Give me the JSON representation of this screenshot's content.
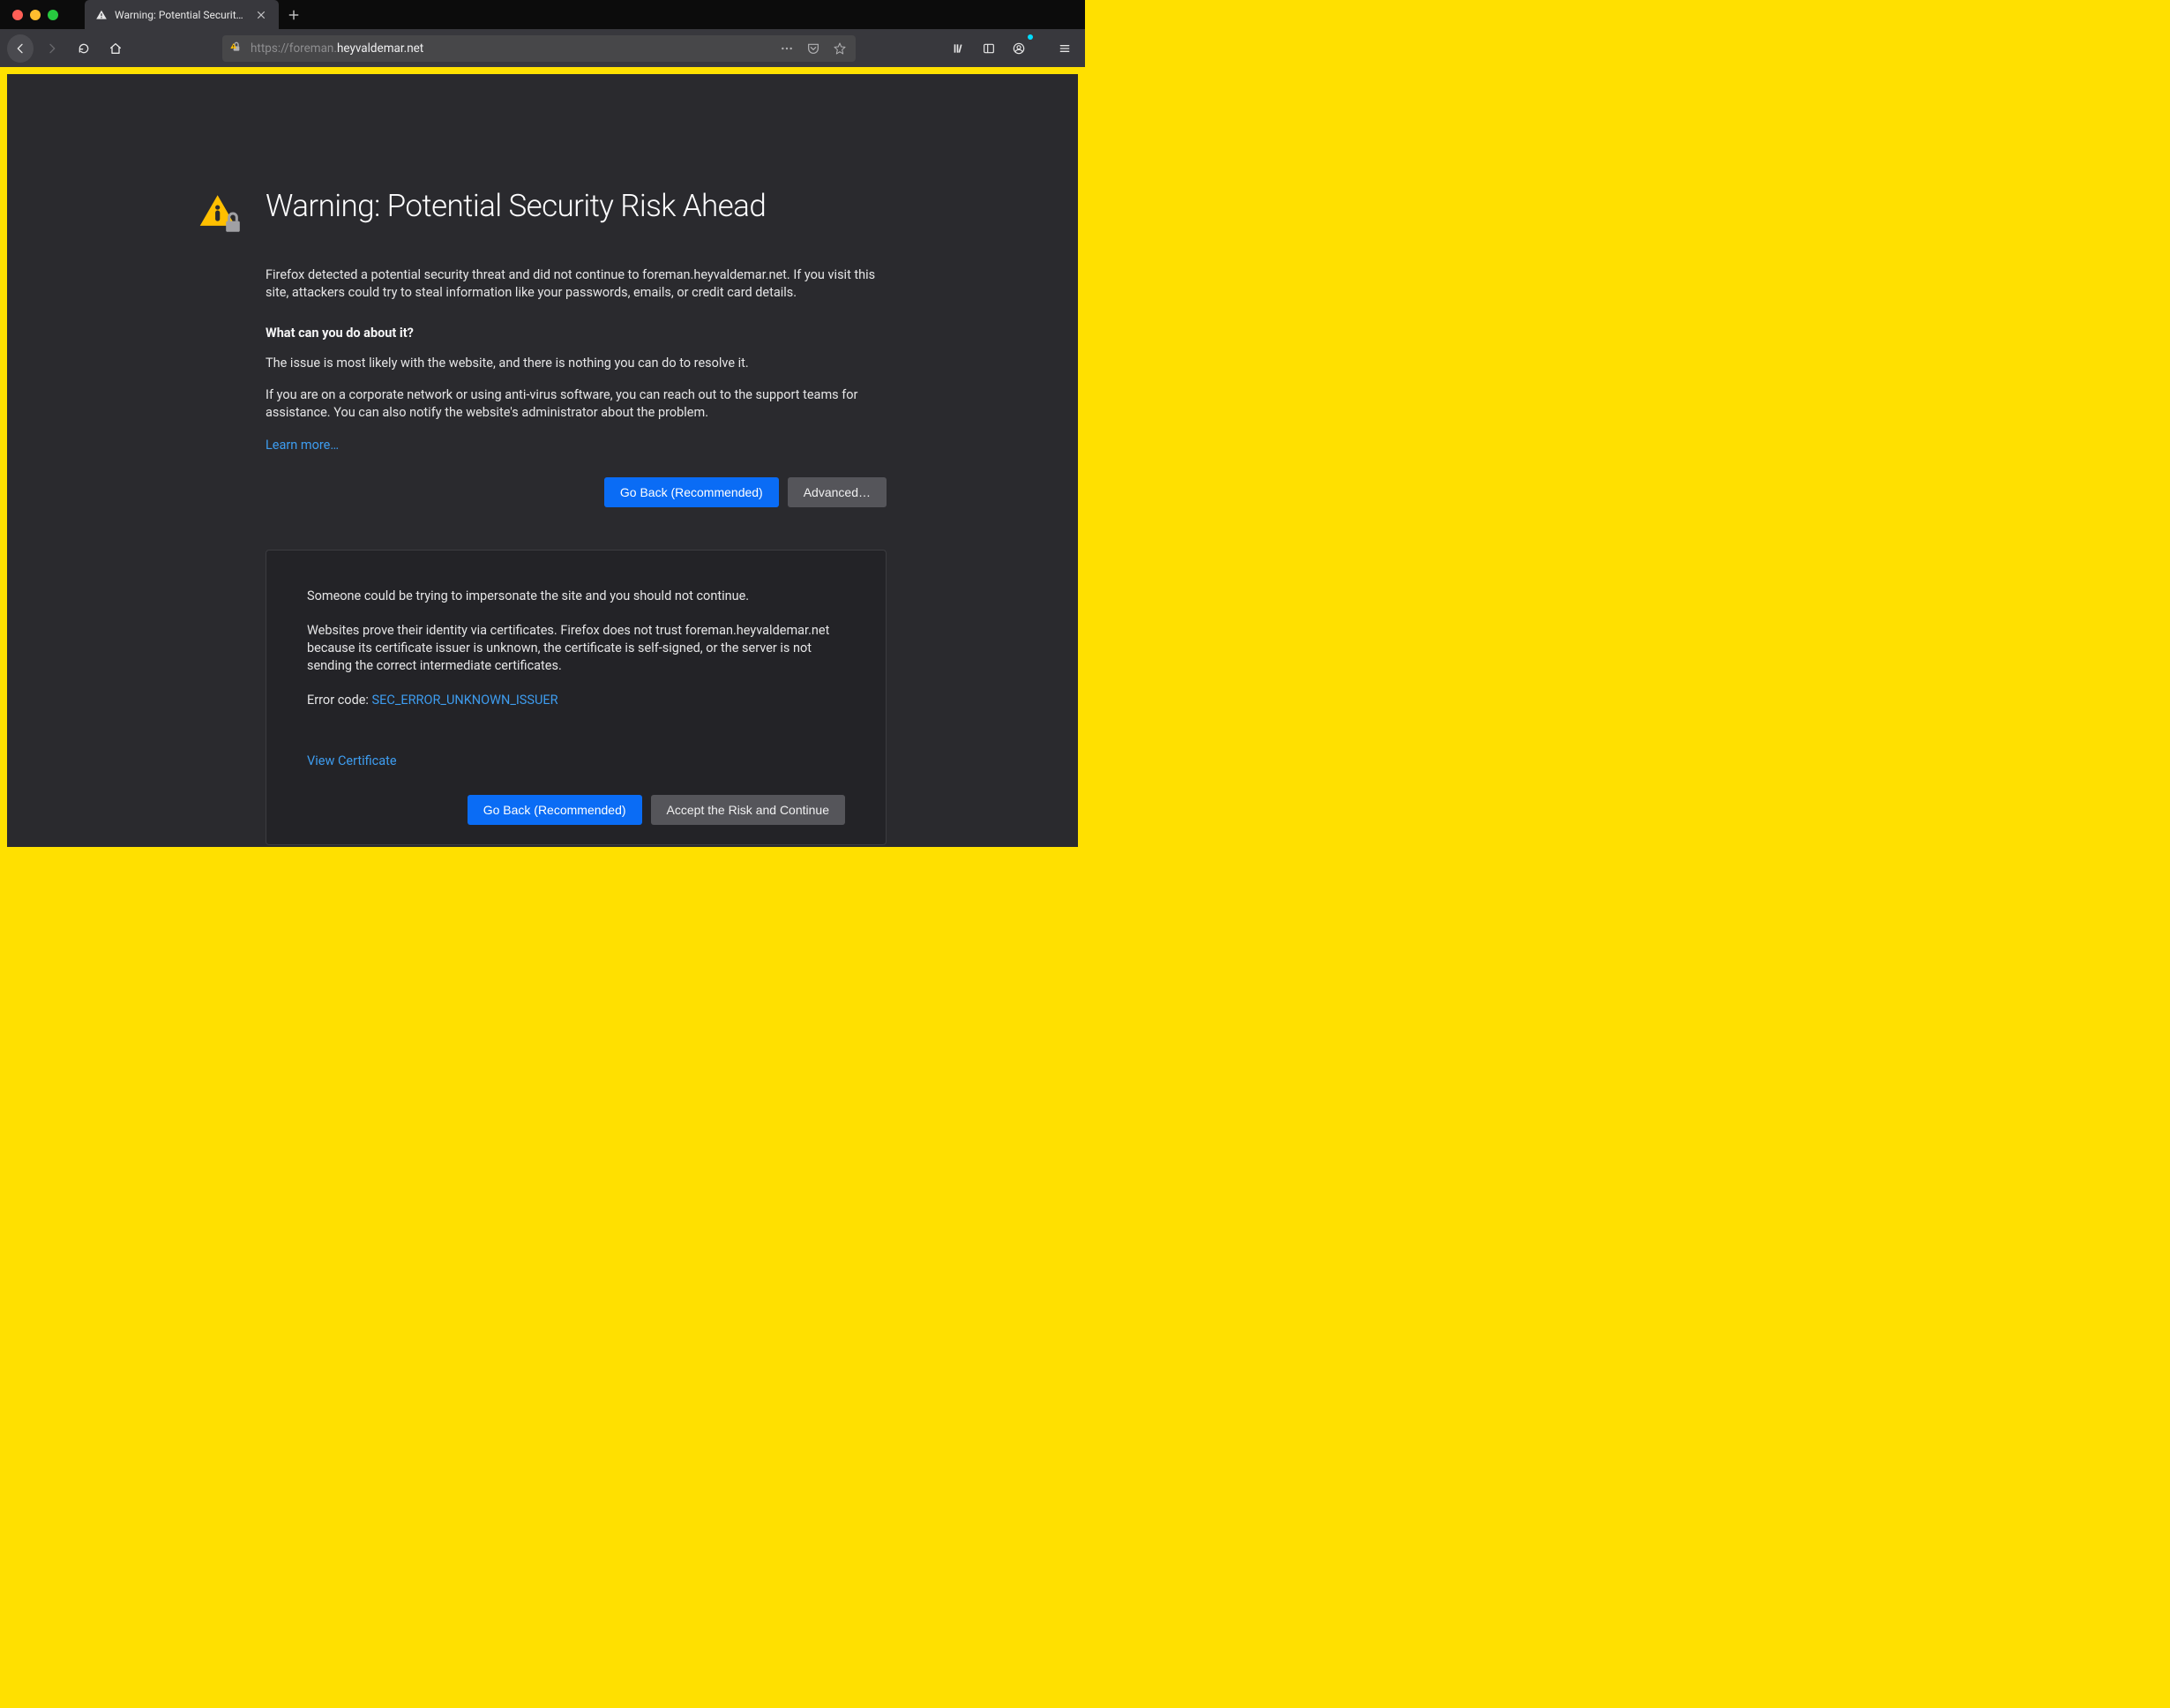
{
  "tab": {
    "title": "Warning: Potential Security Risk"
  },
  "urlbar": {
    "scheme": "https://",
    "subdomain": "foreman.",
    "host": "heyvaldemar.net"
  },
  "page": {
    "title": "Warning: Potential Security Risk Ahead",
    "intro": "Firefox detected a potential security threat and did not continue to foreman.heyvaldemar.net. If you visit this site, attackers could try to steal information like your passwords, emails, or credit card details.",
    "subhead": "What can you do about it?",
    "para1": "The issue is most likely with the website, and there is nothing you can do to resolve it.",
    "para2": "If you are on a corporate network or using anti-virus software, you can reach out to the support teams for assistance. You can also notify the website's administrator about the problem.",
    "learn_more": "Learn more…",
    "go_back": "Go Back (Recommended)",
    "advanced": "Advanced…"
  },
  "advanced_panel": {
    "warn": "Someone could be trying to impersonate the site and you should not continue.",
    "explain": "Websites prove their identity via certificates. Firefox does not trust foreman.heyvaldemar.net because its certificate issuer is unknown, the certificate is self-signed, or the server is not sending the correct intermediate certificates.",
    "error_label": "Error code: ",
    "error_code": "SEC_ERROR_UNKNOWN_ISSUER",
    "view_cert": "View Certificate",
    "go_back": "Go Back (Recommended)",
    "accept": "Accept the Risk and Continue"
  }
}
